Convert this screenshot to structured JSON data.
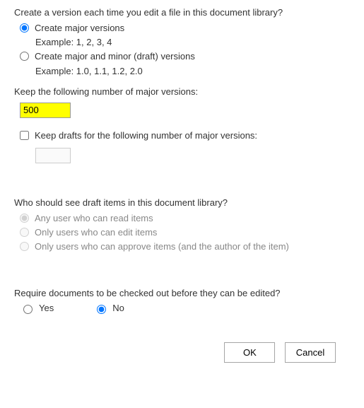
{
  "versioning": {
    "question": "Create a version each time you edit a file in this document library?",
    "option_major": "Create major versions",
    "example_major": "Example: 1, 2, 3, 4",
    "option_minor": "Create major and minor (draft) versions",
    "example_minor": "Example: 1.0, 1.1, 1.2, 2.0",
    "selected": "major"
  },
  "keep_major": {
    "label": "Keep the following number of major versions:",
    "value": "500",
    "highlighted": true
  },
  "keep_drafts": {
    "label": "Keep drafts for the following number of major versions:",
    "checked": false,
    "value": ""
  },
  "draft_security": {
    "question": "Who should see draft items in this document library?",
    "option_any": "Any user who can read items",
    "option_edit": "Only users who can edit items",
    "option_approve": "Only users who can approve items (and the author of the item)",
    "selected": "any",
    "enabled": false
  },
  "checkout": {
    "question": "Require documents to be checked out before they can be edited?",
    "yes": "Yes",
    "no": "No",
    "selected": "no"
  },
  "buttons": {
    "ok": "OK",
    "cancel": "Cancel"
  }
}
